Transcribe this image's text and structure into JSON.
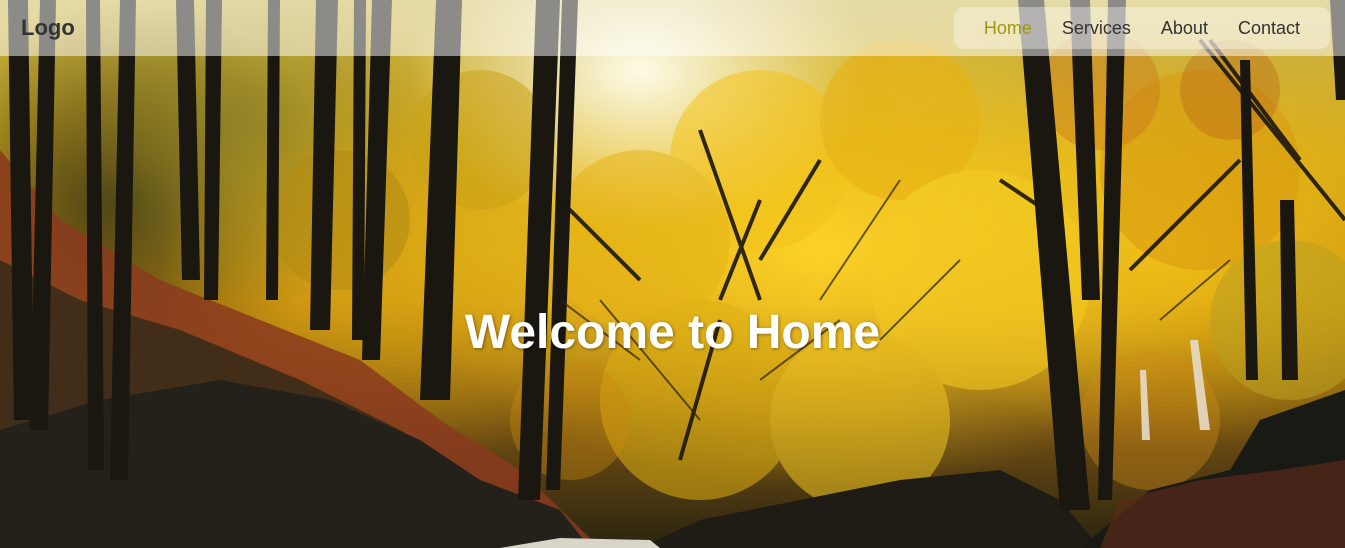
{
  "nav": {
    "logo": "Logo",
    "links": [
      {
        "label": "Home",
        "active": true
      },
      {
        "label": "Services",
        "active": false
      },
      {
        "label": "About",
        "active": false
      },
      {
        "label": "Contact",
        "active": false
      }
    ],
    "active_color": "#a19610",
    "link_color": "#333333"
  },
  "hero": {
    "title": "Welcome to Home",
    "background": "autumn-forest-photo"
  }
}
